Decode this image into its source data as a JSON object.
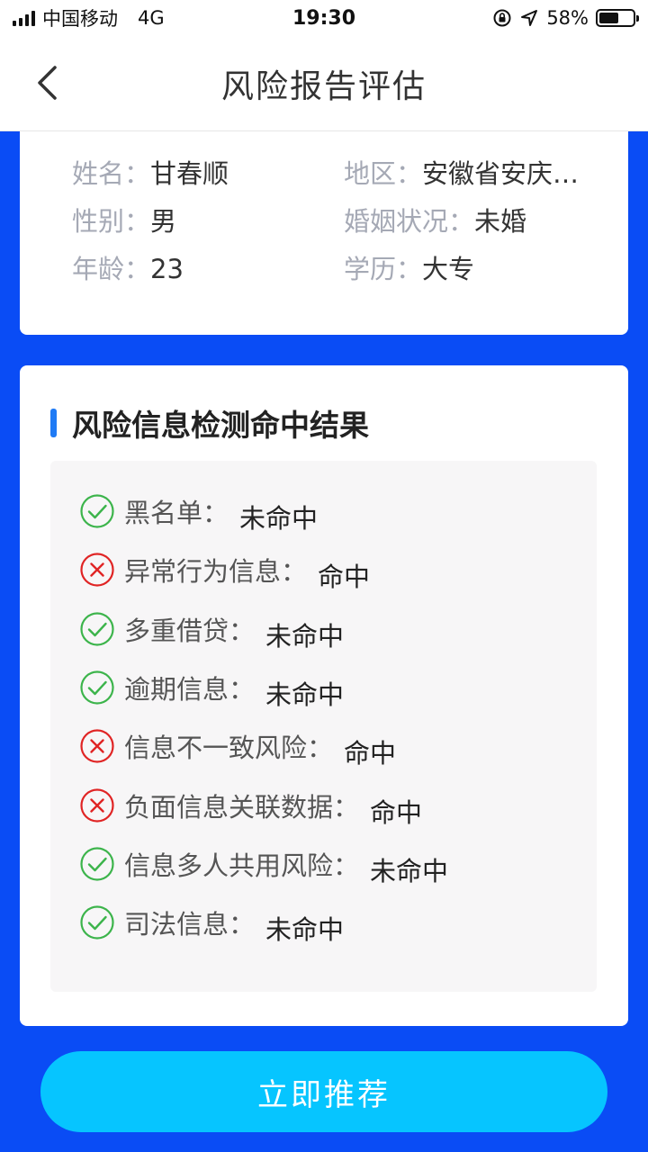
{
  "status_bar": {
    "carrier": "中国移动",
    "network": "4G",
    "time": "19:30",
    "battery": "58%",
    "battery_level": 0.58
  },
  "nav": {
    "back_icon": "chevron-left-icon",
    "title": "风险报告评估"
  },
  "profile": {
    "name_label": "姓名：",
    "name": "甘春顺",
    "region_label": "地区：",
    "region": "安徽省安庆…",
    "gender_label": "性别：",
    "gender": "男",
    "marital_label": "婚姻状况：",
    "marital": "未婚",
    "age_label": "年龄：",
    "age": "23",
    "education_label": "学历：",
    "education": "大专"
  },
  "results": {
    "title": "风险信息检测命中结果",
    "items": [
      {
        "label": "黑名单：",
        "value": "未命中",
        "status": "pass"
      },
      {
        "label": "异常行为信息：",
        "value": "命中",
        "status": "hit"
      },
      {
        "label": "多重借贷：",
        "value": "未命中",
        "status": "pass"
      },
      {
        "label": "逾期信息：",
        "value": "未命中",
        "status": "pass"
      },
      {
        "label": "信息不一致风险：",
        "value": "命中",
        "status": "hit"
      },
      {
        "label": "负面信息关联数据：",
        "value": "命中",
        "status": "hit"
      },
      {
        "label": "信息多人共用风险：",
        "value": "未命中",
        "status": "pass"
      },
      {
        "label": "司法信息：",
        "value": "未命中",
        "status": "pass"
      }
    ]
  },
  "button": {
    "label": "立即推荐"
  },
  "colors": {
    "background": "#0a4cf5",
    "accent": "#1f7bf5",
    "button": "#06c5ff",
    "pass": "#3cb44b",
    "hit": "#e02424"
  }
}
